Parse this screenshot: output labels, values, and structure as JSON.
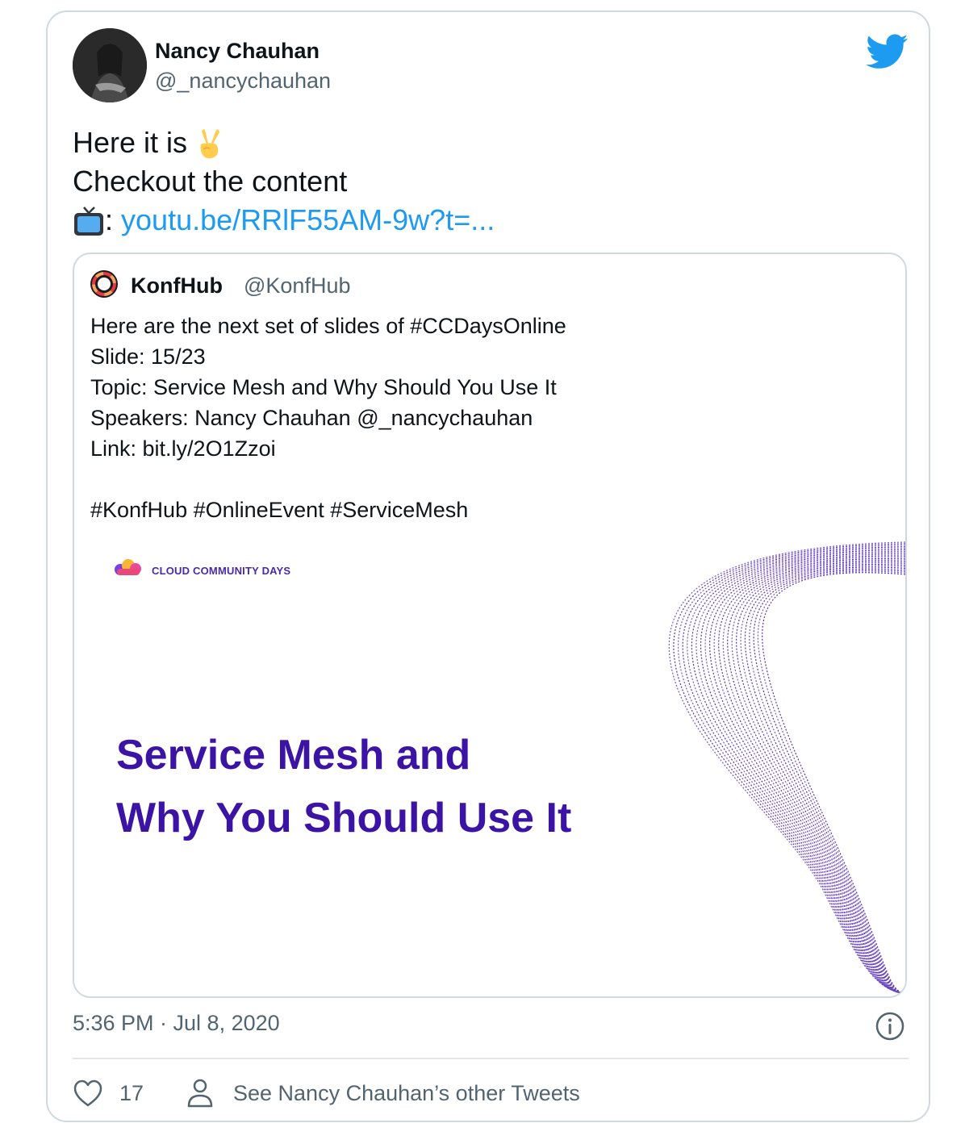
{
  "author": {
    "name": "Nancy Chauhan",
    "handle": "@_nancychauhan",
    "avatar_icon": "avatar-photo"
  },
  "brand_icon": "twitter-bird-icon",
  "tweet": {
    "line1": "Here it is",
    "line1_emoji": "victory-hand-emoji",
    "line2": "Checkout the content",
    "line3_emoji": "tv-emoji",
    "line3_prefix": ":",
    "link_text": "youtu.be/RRlF55AM-9w?t=..."
  },
  "quoted_tweet": {
    "name": "KonfHub",
    "handle": "@KonfHub",
    "lines": [
      "Here are the next set of slides of #CCDaysOnline",
      "Slide: 15/23",
      "Topic: Service Mesh and Why Should You Use It",
      "Speakers: Nancy Chauhan @_nancychauhan",
      "Link: bit.ly/2O1Zzoi",
      "",
      "#KonfHub #OnlineEvent #ServiceMesh"
    ],
    "slide": {
      "brand": "CLOUD COMMUNITY DAYS",
      "title_line1": "Service Mesh and",
      "title_line2": "Why You Should Use It",
      "title_color": "#3b14a6"
    }
  },
  "footer": {
    "timestamp": "5:36 PM · Jul 8, 2020",
    "like_count": "17",
    "other_tweets_label": "See Nancy Chauhan’s other Tweets"
  },
  "colors": {
    "link": "#1d9bf0",
    "secondary_text": "#536471",
    "border": "#cfd9de"
  }
}
